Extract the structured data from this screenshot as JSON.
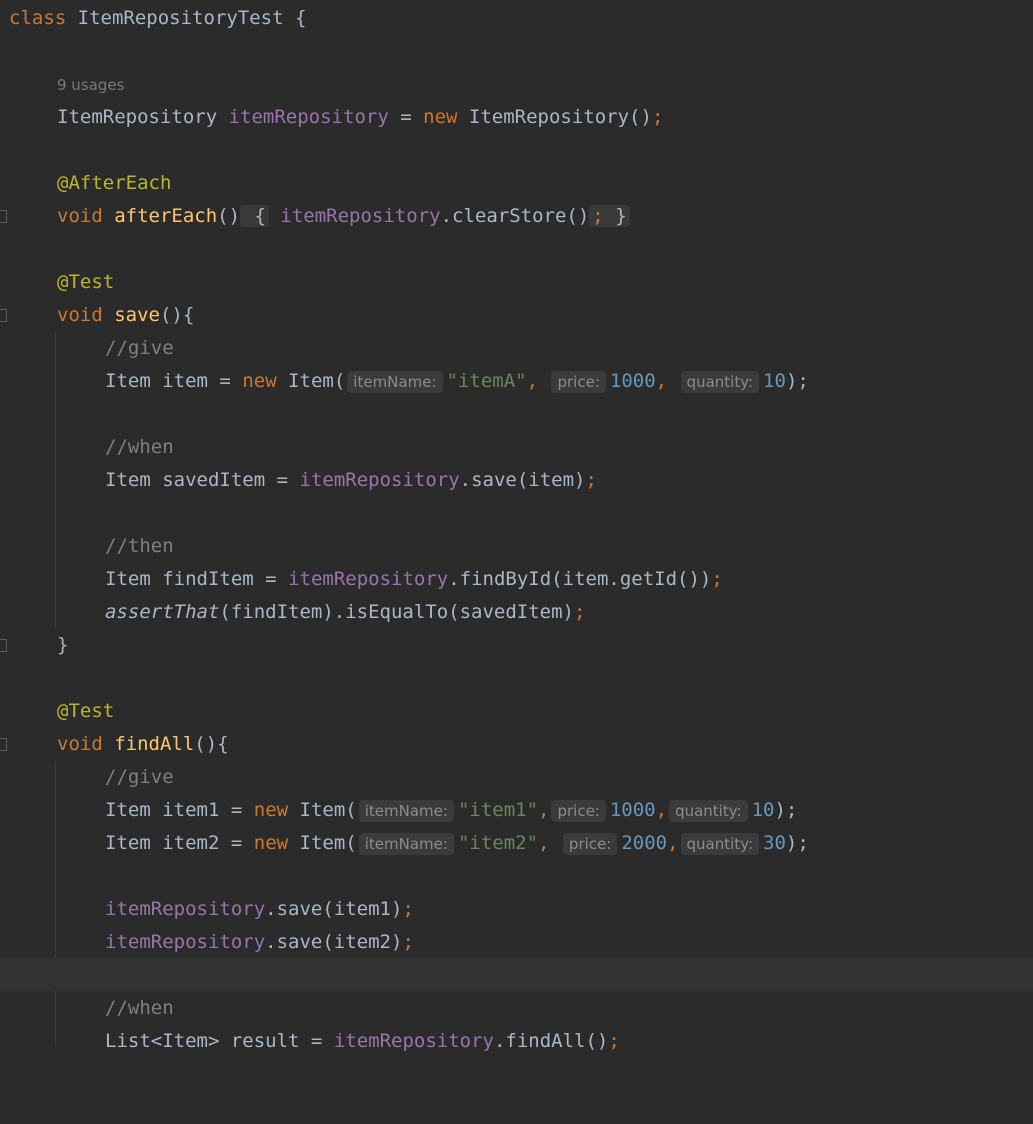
{
  "usage_hint": "9 usages",
  "param_hints": {
    "itemName": "itemName:",
    "price": "price:",
    "quantity": "quantity:"
  },
  "code": {
    "class_kw": "class",
    "class_name": "ItemRepositoryTest",
    "open_brace": "{",
    "close_brace": "}",
    "type_repo": "ItemRepository",
    "repo_field": "itemRepository",
    "assign": "=",
    "new_kw": "new",
    "ctor_call": "ItemRepository()",
    "semi": ";",
    "anno_after": "@AfterEach",
    "anno_test": "@Test",
    "void_kw": "void",
    "m_aftereach": "afterEach",
    "parens": "()",
    "clear_call": ".clearStore()",
    "m_save": "save",
    "m_findall": "findAll",
    "brace_open_inline": "(){",
    "cmt_give": "//give",
    "cmt_when": "//when",
    "cmt_then": "//then",
    "item_decl": "Item item",
    "item_ctor": "Item(",
    "str_itemA": "\"itemA\"",
    "comma": ",",
    "num_1000": "1000",
    "num_10": "10",
    "close_paren_semi": ");",
    "saved_decl": "Item savedItem",
    "save_item_call": ".save(item)",
    "find_decl": "Item findItem",
    "findbyid_call": ".findById(item.getId())",
    "assert_that": "assertThat",
    "assert_rest": "(findItem).isEqualTo(savedItem)",
    "item1_decl": "Item item1",
    "item2_decl": "Item item2",
    "str_item1": "\"item1\"",
    "str_item2": "\"item2\"",
    "num_2000": "2000",
    "num_30": "30",
    "save_item1": ".save(item1)",
    "save_item2": ".save(item2)",
    "list_decl": "List<Item> result",
    "findall_call": ".findAll()"
  }
}
